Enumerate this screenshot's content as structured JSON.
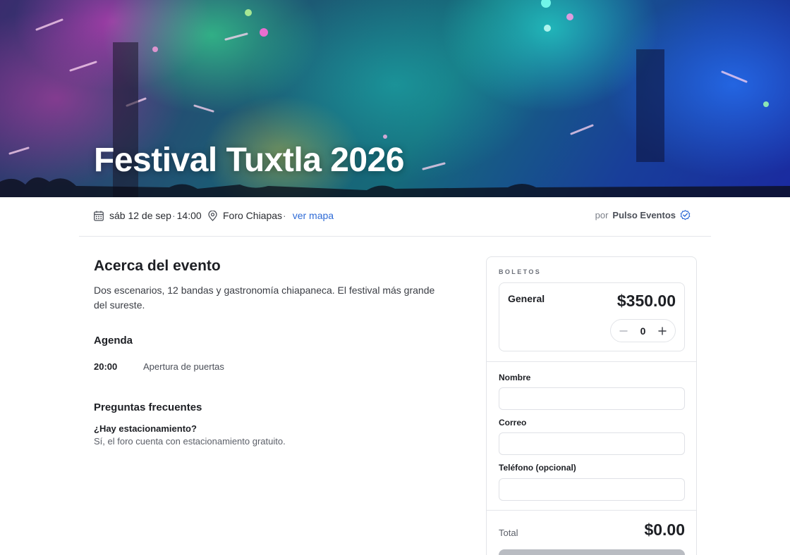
{
  "event": {
    "title": "Festival Tuxtla 2026",
    "date": "sáb 12 de sep",
    "separator": "·",
    "time": "14:00",
    "venue": "Foro Chiapas",
    "map_link": "ver mapa",
    "organizer_prefix": "por",
    "organizer": "Pulso Eventos"
  },
  "about": {
    "heading": "Acerca del evento",
    "description": "Dos escenarios, 12 bandas y gastronomía chiapaneca. El festival más grande del sureste."
  },
  "agenda": {
    "heading": "Agenda",
    "items": [
      {
        "time": "20:00",
        "label": "Apertura de puertas"
      }
    ]
  },
  "faq": {
    "heading": "Preguntas frecuentes",
    "items": [
      {
        "question": "¿Hay estacionamiento?",
        "answer": "Sí, el foro cuenta con estacionamiento gratuito."
      }
    ]
  },
  "tickets": {
    "heading": "BOLETOS",
    "items": [
      {
        "name": "General",
        "price": "$350.00",
        "quantity": "0"
      }
    ]
  },
  "form": {
    "name_label": "Nombre",
    "name_value": "",
    "email_label": "Correo",
    "email_value": "",
    "phone_label": "Teléfono (opcional)",
    "phone_value": ""
  },
  "summary": {
    "total_label": "Total",
    "total_value": "$0.00"
  },
  "colors": {
    "link": "#2f6bd6",
    "verified": "#2f6bd6",
    "button_disabled": "#b9bcc2"
  },
  "icons": {
    "date": "calendar-icon",
    "venue": "map-pin-icon",
    "verified": "verified-check-icon",
    "decrement": "minus-icon",
    "increment": "plus-icon"
  }
}
